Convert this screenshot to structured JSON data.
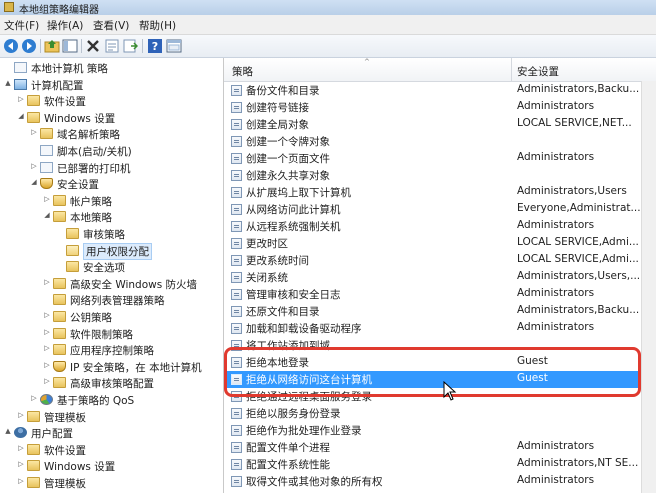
{
  "window": {
    "title": "本地组策略编辑器"
  },
  "menu": [
    "文件(F)",
    "操作(A)",
    "查看(V)",
    "帮助(H)"
  ],
  "toolbar": [
    {
      "icon": "back-arrow-icon"
    },
    {
      "icon": "forward-arrow-icon"
    },
    {
      "icon": "up-folder-icon"
    },
    {
      "icon": "show-hide-tree-icon"
    },
    {
      "icon": "delete-x-icon"
    },
    {
      "icon": "properties-icon"
    },
    {
      "icon": "export-list-icon"
    },
    {
      "icon": "help-icon"
    },
    {
      "icon": "console-view-icon"
    }
  ],
  "tree": [
    {
      "label": "本地计算机 策略",
      "level": 0,
      "arrow": "",
      "icon": "doc"
    },
    {
      "label": "计算机配置",
      "level": 0,
      "arrow": "▲",
      "icon": "pc"
    },
    {
      "label": "软件设置",
      "level": 1,
      "arrow": "▷",
      "icon": "folder"
    },
    {
      "label": "Windows 设置",
      "level": 1,
      "arrow": "◢",
      "icon": "folder"
    },
    {
      "label": "域名解析策略",
      "level": 2,
      "arrow": "▷",
      "icon": "folder"
    },
    {
      "label": "脚本(启动/关机)",
      "level": 2,
      "arrow": "",
      "icon": "doc"
    },
    {
      "label": "已部署的打印机",
      "level": 2,
      "arrow": "▷",
      "icon": "doc"
    },
    {
      "label": "安全设置",
      "level": 2,
      "arrow": "◢",
      "icon": "shield"
    },
    {
      "label": "帐户策略",
      "level": 3,
      "arrow": "▷",
      "icon": "folder"
    },
    {
      "label": "本地策略",
      "level": 3,
      "arrow": "◢",
      "icon": "folder"
    },
    {
      "label": "审核策略",
      "level": 4,
      "arrow": "",
      "icon": "folder"
    },
    {
      "label": "用户权限分配",
      "level": 4,
      "arrow": "",
      "icon": "folder",
      "selected": true
    },
    {
      "label": "安全选项",
      "level": 4,
      "arrow": "",
      "icon": "folder"
    },
    {
      "label": "高级安全 Windows 防火墙",
      "level": 3,
      "arrow": "▷",
      "icon": "folder"
    },
    {
      "label": "网络列表管理器策略",
      "level": 3,
      "arrow": "",
      "icon": "folder"
    },
    {
      "label": "公钥策略",
      "level": 3,
      "arrow": "▷",
      "icon": "folder"
    },
    {
      "label": "软件限制策略",
      "level": 3,
      "arrow": "▷",
      "icon": "folder"
    },
    {
      "label": "应用程序控制策略",
      "level": 3,
      "arrow": "▷",
      "icon": "folder"
    },
    {
      "label": "IP 安全策略，在 本地计算机",
      "level": 3,
      "arrow": "▷",
      "icon": "shield"
    },
    {
      "label": "高级审核策略配置",
      "level": 3,
      "arrow": "▷",
      "icon": "folder"
    },
    {
      "label": "基于策略的 QoS",
      "level": 2,
      "arrow": "▷",
      "icon": "pie"
    },
    {
      "label": "管理模板",
      "level": 1,
      "arrow": "▷",
      "icon": "folder"
    },
    {
      "label": "用户配置",
      "level": 0,
      "arrow": "▲",
      "icon": "user"
    },
    {
      "label": "软件设置",
      "level": 1,
      "arrow": "▷",
      "icon": "folder"
    },
    {
      "label": "Windows 设置",
      "level": 1,
      "arrow": "▷",
      "icon": "folder"
    },
    {
      "label": "管理模板",
      "level": 1,
      "arrow": "▷",
      "icon": "folder"
    }
  ],
  "list": {
    "columns": [
      "策略",
      "安全设置"
    ],
    "rows": [
      {
        "policy": "备份文件和目录",
        "setting": "Administrators,Backu..."
      },
      {
        "policy": "创建符号链接",
        "setting": "Administrators"
      },
      {
        "policy": "创建全局对象",
        "setting": "LOCAL SERVICE,NET..."
      },
      {
        "policy": "创建一个令牌对象",
        "setting": ""
      },
      {
        "policy": "创建一个页面文件",
        "setting": "Administrators"
      },
      {
        "policy": "创建永久共享对象",
        "setting": ""
      },
      {
        "policy": "从扩展坞上取下计算机",
        "setting": "Administrators,Users"
      },
      {
        "policy": "从网络访问此计算机",
        "setting": "Everyone,Administrat..."
      },
      {
        "policy": "从远程系统强制关机",
        "setting": "Administrators"
      },
      {
        "policy": "更改时区",
        "setting": "LOCAL SERVICE,Admi..."
      },
      {
        "policy": "更改系统时间",
        "setting": "LOCAL SERVICE,Admi..."
      },
      {
        "policy": "关闭系统",
        "setting": "Administrators,Users,..."
      },
      {
        "policy": "管理审核和安全日志",
        "setting": "Administrators"
      },
      {
        "policy": "还原文件和目录",
        "setting": "Administrators,Backu..."
      },
      {
        "policy": "加载和卸载设备驱动程序",
        "setting": "Administrators"
      },
      {
        "policy": "将工作站添加到域",
        "setting": ""
      },
      {
        "policy": "拒绝本地登录",
        "setting": "Guest"
      },
      {
        "policy": "拒绝从网络访问这台计算机",
        "setting": "Guest",
        "selected": true
      },
      {
        "policy": "拒绝通过远程桌面服务登录",
        "setting": ""
      },
      {
        "policy": "拒绝以服务身份登录",
        "setting": ""
      },
      {
        "policy": "拒绝作为批处理作业登录",
        "setting": ""
      },
      {
        "policy": "配置文件单个进程",
        "setting": "Administrators"
      },
      {
        "policy": "配置文件系统性能",
        "setting": "Administrators,NT SE..."
      },
      {
        "policy": "取得文件或其他对象的所有权",
        "setting": "Administrators"
      }
    ]
  },
  "colors": {
    "selection": "#3399ff",
    "highlight_box": "#e03a2f"
  }
}
